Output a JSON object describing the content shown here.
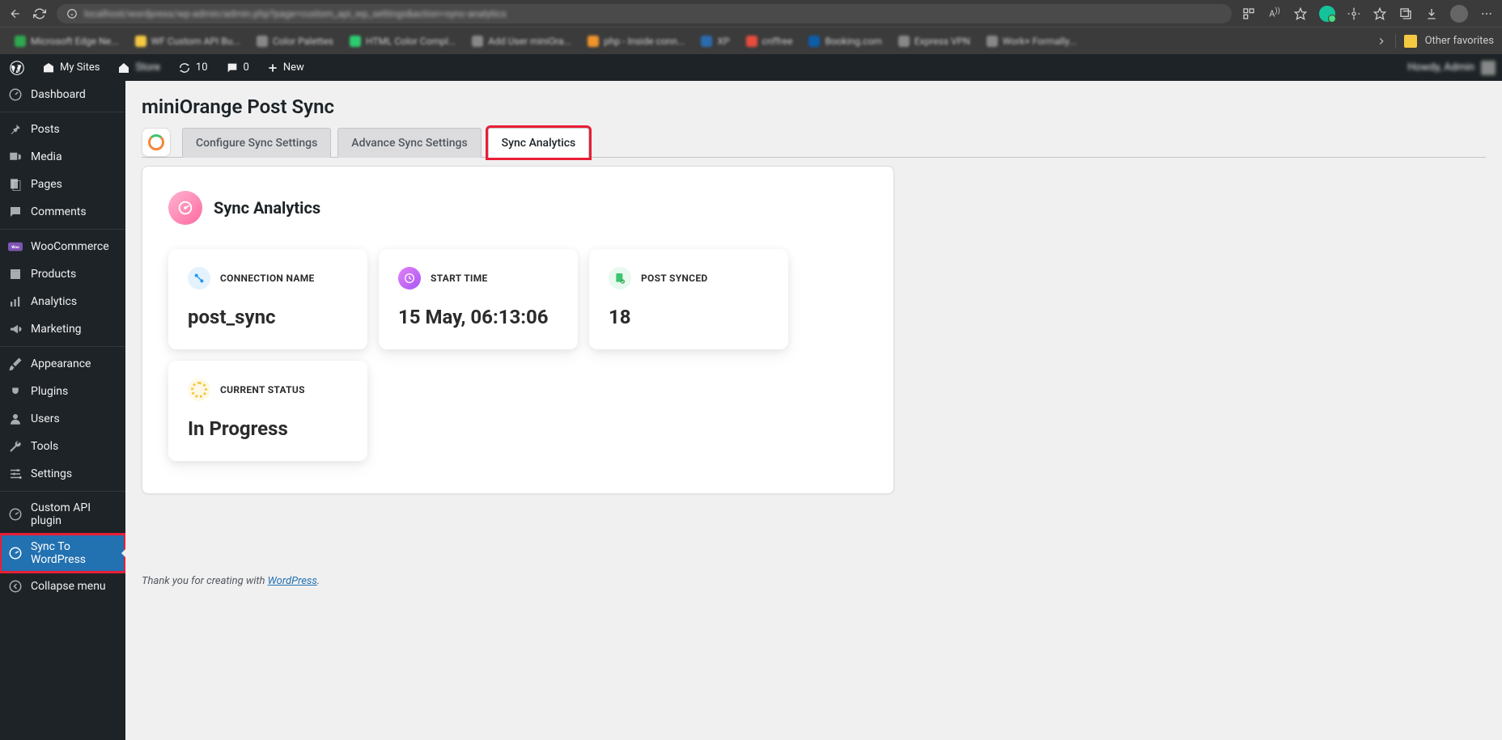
{
  "browser": {
    "url_blurred": "localhost/wordpress/wp-admin/admin.php?page=custom_api_wp_settings&action=sync-analytics",
    "other_favorites": "Other favorites"
  },
  "bookmarks": [
    {
      "label": "Microsoft Edge Ne...",
      "color": "#2fa84f"
    },
    {
      "label": "WF Custom API Bu...",
      "color": "#f5c842"
    },
    {
      "label": "Color Palettes",
      "color": "#888"
    },
    {
      "label": "HTML Color Compl...",
      "color": "#2ecc71"
    },
    {
      "label": "Add User miniOra...",
      "color": "#888"
    },
    {
      "label": "php - Inside conn...",
      "color": "#f0932b"
    },
    {
      "label": "XP",
      "color": "#2b6cb0"
    },
    {
      "label": "cnffree",
      "color": "#e74c3c"
    },
    {
      "label": "Booking.com",
      "color": "#0b5eaa"
    },
    {
      "label": "Express VPN",
      "color": "#888"
    },
    {
      "label": "Work× Formally...",
      "color": "#888"
    }
  ],
  "adminbar": {
    "my_sites": "My Sites",
    "site_name": "Store",
    "updates": "10",
    "comments": "0",
    "new": "New",
    "howdy": "Howdy, Admin"
  },
  "sidebar": {
    "items": [
      {
        "label": "Dashboard",
        "icon": "dashboard"
      },
      {
        "label": "Posts",
        "icon": "pin"
      },
      {
        "label": "Media",
        "icon": "media"
      },
      {
        "label": "Pages",
        "icon": "page"
      },
      {
        "label": "Comments",
        "icon": "comment"
      },
      {
        "label": "WooCommerce",
        "icon": "woo"
      },
      {
        "label": "Products",
        "icon": "products"
      },
      {
        "label": "Analytics",
        "icon": "analytics"
      },
      {
        "label": "Marketing",
        "icon": "marketing"
      },
      {
        "label": "Appearance",
        "icon": "brush"
      },
      {
        "label": "Plugins",
        "icon": "plug"
      },
      {
        "label": "Users",
        "icon": "users"
      },
      {
        "label": "Tools",
        "icon": "wrench"
      },
      {
        "label": "Settings",
        "icon": "sliders"
      },
      {
        "label": "Custom API plugin",
        "icon": "gauge"
      },
      {
        "label": "Sync To WordPress",
        "icon": "gauge",
        "current": true
      },
      {
        "label": "Collapse menu",
        "icon": "collapse"
      }
    ]
  },
  "page": {
    "title": "miniOrange Post Sync",
    "tabs": [
      {
        "label": "Configure Sync Settings",
        "active": false
      },
      {
        "label": "Advance Sync Settings",
        "active": false
      },
      {
        "label": "Sync Analytics",
        "active": true,
        "highlighted": true
      }
    ],
    "panel_title": "Sync Analytics",
    "cards": {
      "connection": {
        "label": "CONNECTION NAME",
        "value": "post_sync"
      },
      "start": {
        "label": "START TIME",
        "value": "15 May, 06:13:06"
      },
      "synced": {
        "label": "POST SYNCED",
        "value": "18"
      },
      "status": {
        "label": "CURRENT STATUS",
        "value": "In Progress"
      }
    }
  },
  "footer": {
    "text": "Thank you for creating with ",
    "link": "WordPress"
  }
}
